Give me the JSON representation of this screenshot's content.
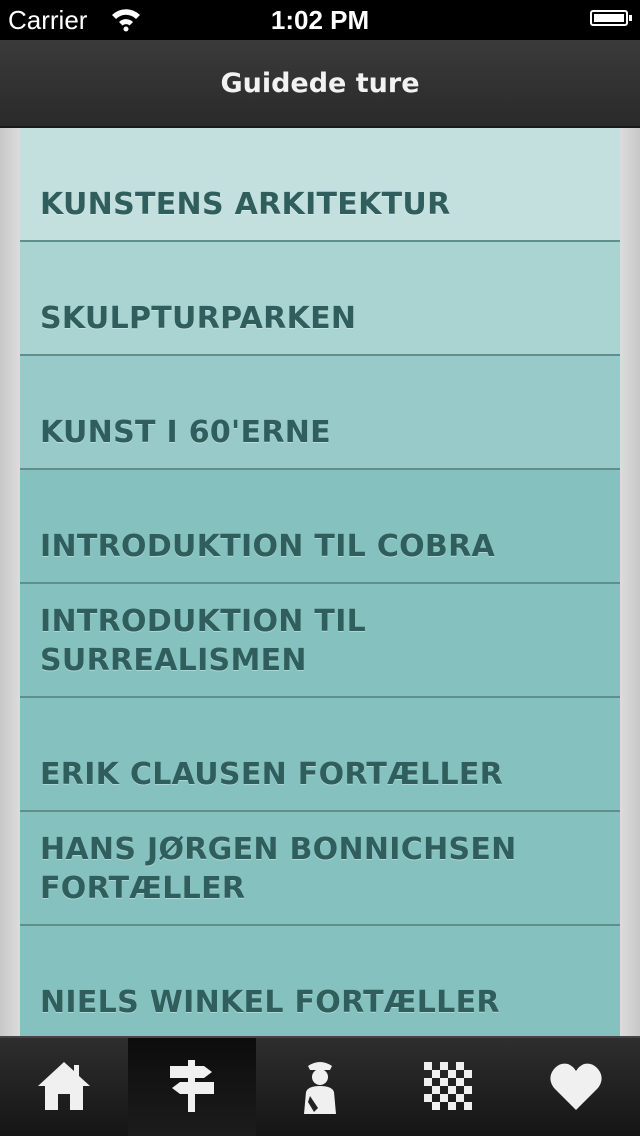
{
  "status_bar": {
    "carrier": "Carrier",
    "time": "1:02 PM"
  },
  "nav": {
    "title": "Guidede ture"
  },
  "tours": [
    {
      "label": "KUNSTENS ARKITEKTUR",
      "color": "#c3e0df"
    },
    {
      "label": "SKULPTURPARKEN",
      "color": "#a9d4d2"
    },
    {
      "label": "KUNST I 60'ERNE",
      "color": "#97cac8"
    },
    {
      "label": "INTRODUKTION TIL COBRA",
      "color": "#84c1bf"
    },
    {
      "label": "INTRODUKTION TIL SURREALISMEN",
      "color": "#84c1bf"
    },
    {
      "label": "ERIK CLAUSEN FORTÆLLER",
      "color": "#84c1bf"
    },
    {
      "label": "HANS JØRGEN BONNICHSEN FORTÆLLER",
      "color": "#84c1bf"
    },
    {
      "label": "NIELS WINKEL FORTÆLLER",
      "color": "#84c1bf"
    }
  ],
  "tab_bar": {
    "items": [
      {
        "name": "tab-home",
        "icon": "home-icon",
        "active": false
      },
      {
        "name": "tab-tours",
        "icon": "signpost-icon",
        "active": true
      },
      {
        "name": "tab-guide",
        "icon": "person-icon",
        "active": false
      },
      {
        "name": "tab-qr",
        "icon": "qr-code-icon",
        "active": false
      },
      {
        "name": "tab-favorites",
        "icon": "heart-icon",
        "active": false
      }
    ]
  }
}
